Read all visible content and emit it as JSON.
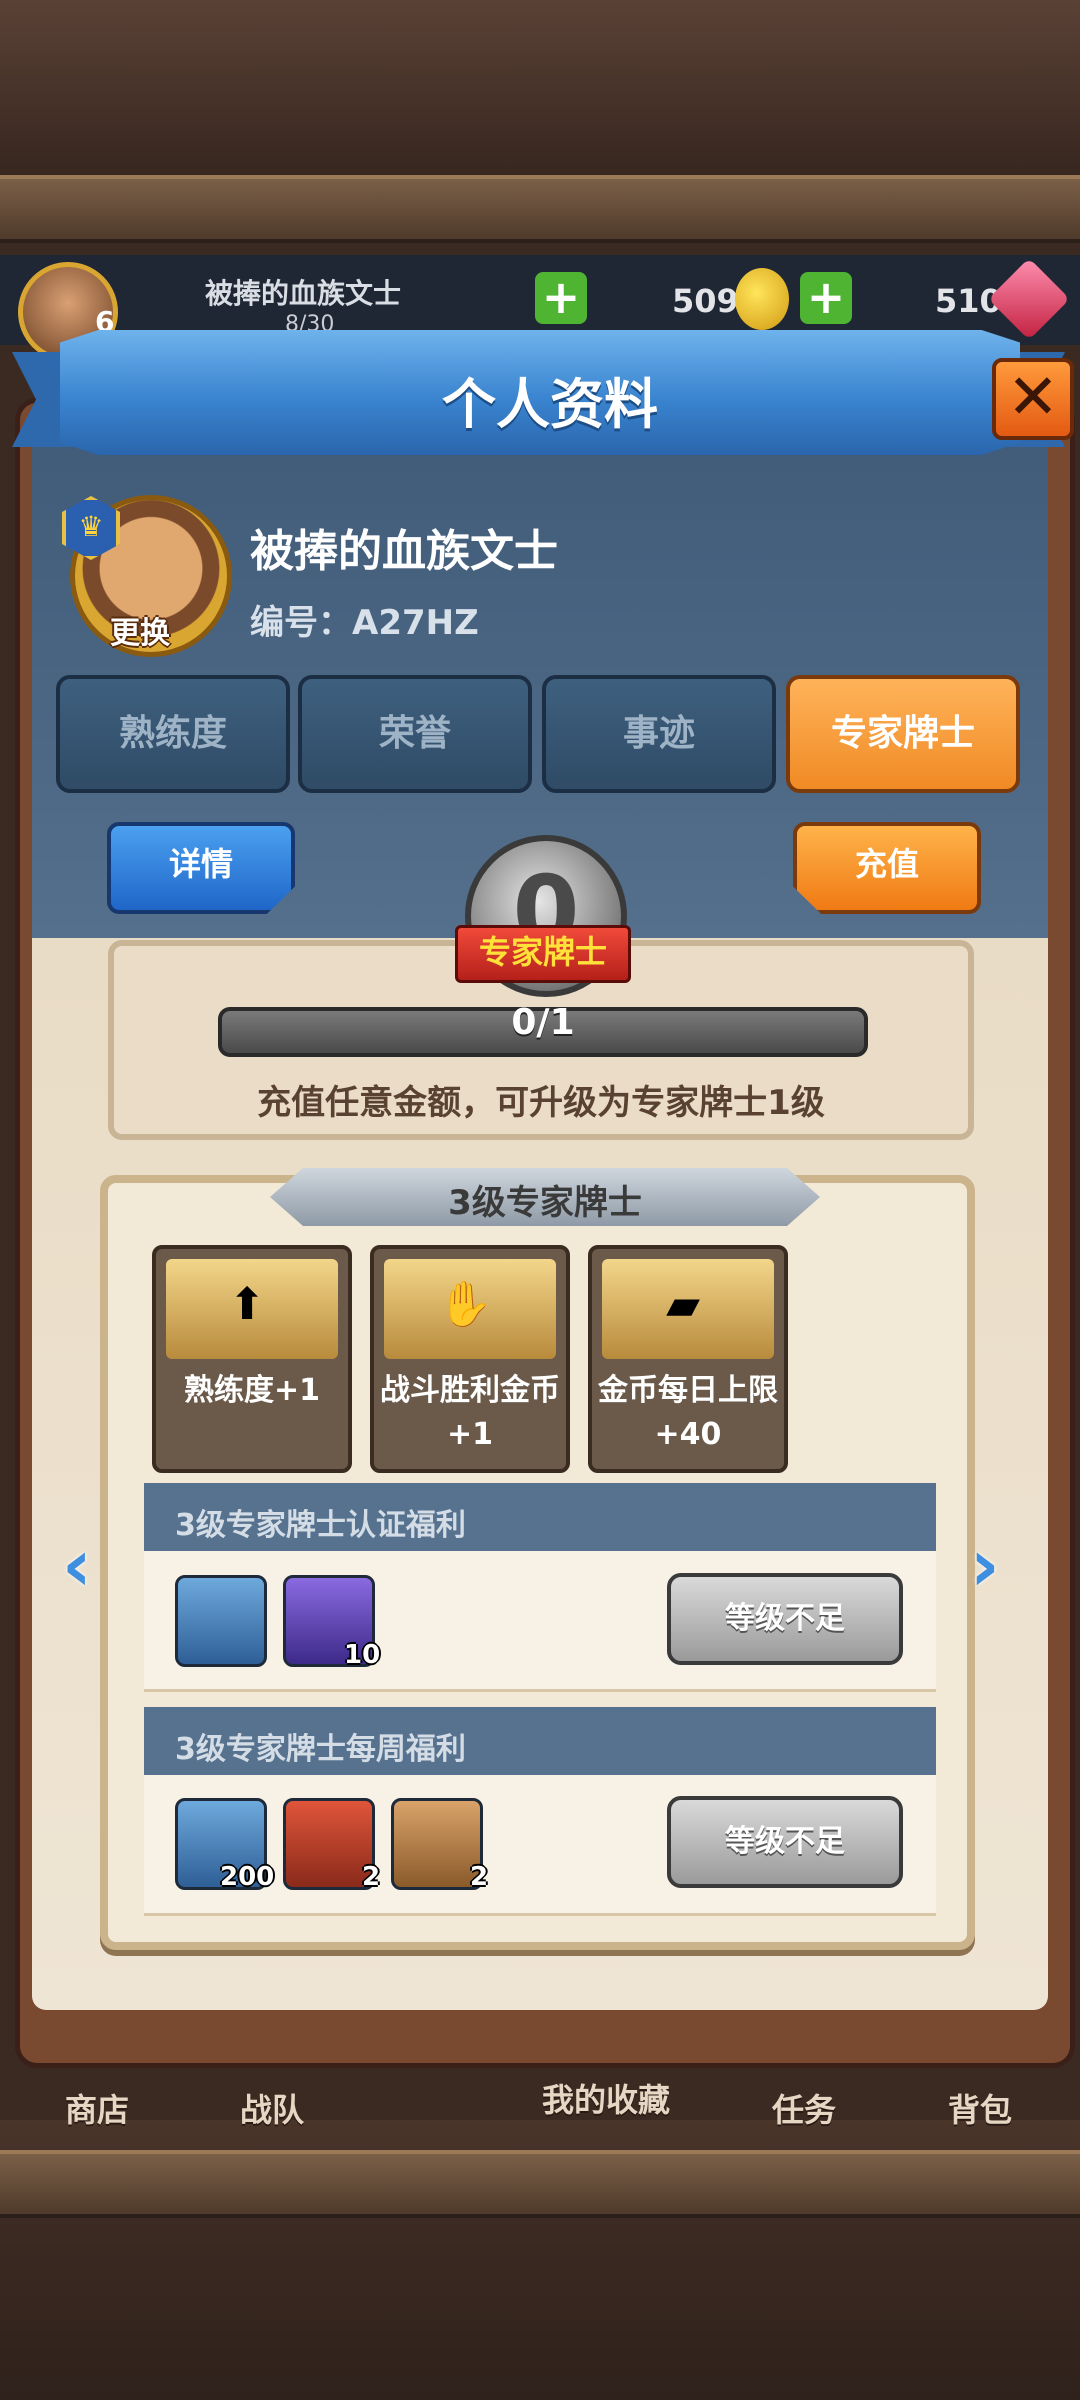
{
  "topbar": {
    "player_name": "被捧的血族文士",
    "level": "6",
    "exp": "8/30",
    "coins": "509",
    "gems": "510"
  },
  "modal": {
    "title": "个人资料",
    "close_label": "✕"
  },
  "profile": {
    "name": "被捧的血族文士",
    "id": "编号：A27HZ",
    "change_avatar": "更换",
    "crown": "♛"
  },
  "tabs": [
    {
      "label": "熟练度",
      "active": false
    },
    {
      "label": "荣誉",
      "active": false
    },
    {
      "label": "事迹",
      "active": false
    },
    {
      "label": "专家牌士",
      "active": true
    }
  ],
  "expert": {
    "detail_button": "详情",
    "recharge_button": "充值",
    "level_number": "0",
    "badge_label": "专家牌士",
    "progress": {
      "current": 0,
      "max": 1,
      "text": "0/1"
    },
    "description": "充值任意金额，可升级为专家牌士1级"
  },
  "level_card": {
    "title": "3级专家牌士",
    "perks": [
      {
        "icon": "level-up-icon",
        "label": "熟练度+1"
      },
      {
        "icon": "coin-hand-icon",
        "label": "战斗胜利金币+1"
      },
      {
        "icon": "gold-chest-icon",
        "label": "金币每日上限+40"
      }
    ],
    "certification": {
      "title": "3级专家牌士认证福利",
      "items": [
        {
          "icon": "dragon-avatar-icon",
          "count": ""
        },
        {
          "icon": "card-pack-icon",
          "count": "10"
        }
      ],
      "button": "等级不足"
    },
    "weekly": {
      "title": "3级专家牌士每周福利",
      "items": [
        {
          "icon": "gold-coin-icon",
          "count": "200"
        },
        {
          "icon": "treasure-chest-icon",
          "count": "2"
        },
        {
          "icon": "card-pouch-icon",
          "count": "2"
        }
      ],
      "button": "等级不足"
    }
  },
  "bottom_nav": [
    "商店",
    "战队",
    "我的收藏",
    "任务",
    "背包"
  ],
  "colors": {
    "accent_orange": "#f08a24",
    "accent_blue": "#2a66ad",
    "panel_paper": "#f2e9d7",
    "section_header": "#56728f"
  }
}
